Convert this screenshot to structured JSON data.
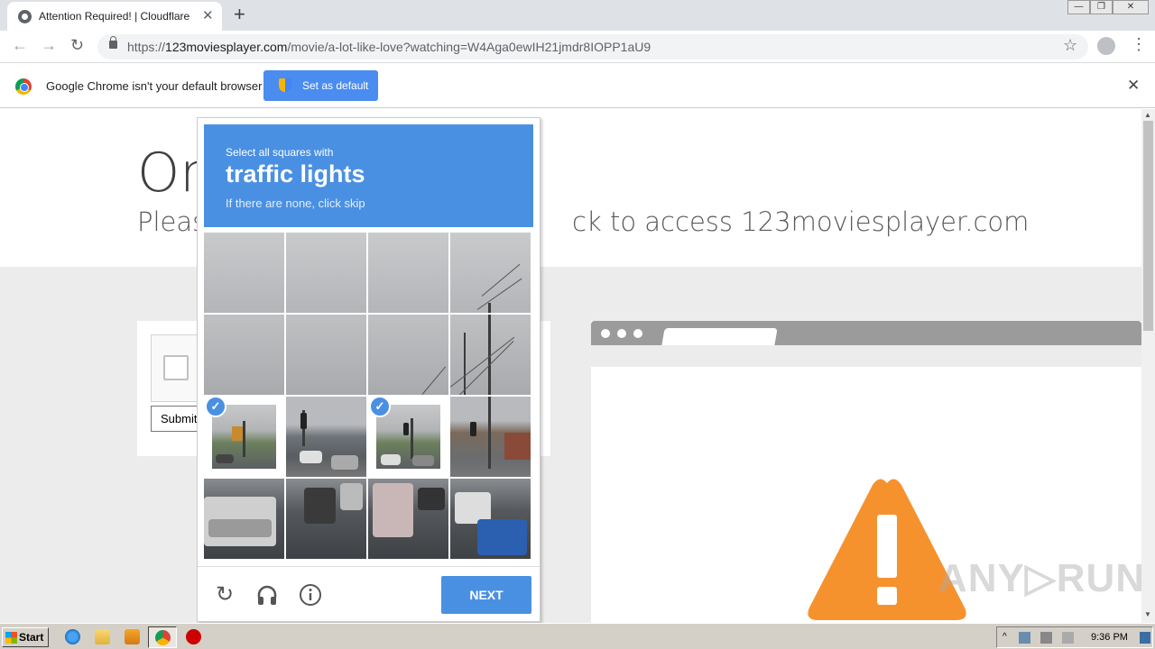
{
  "browser": {
    "tab_title": "Attention Required! | Cloudflare",
    "tab_close": "✕",
    "new_tab": "+",
    "url_domain": "123moviesplayer.com",
    "url_prefix": "https://",
    "url_path": "/movie/a-lot-like-love?watching=W4Aga0ewIH21jmdr8IOPP1aU9",
    "back_icon": "←",
    "forward_icon": "→",
    "reload_icon": "↻",
    "star_icon": "☆",
    "menu_icon": "⋮"
  },
  "infobar": {
    "message": "Google Chrome isn't your default browser",
    "button_label": "Set as default",
    "close": "✕"
  },
  "page": {
    "heading": "On",
    "subheading_left": "Pleas",
    "subheading_right": "ck to access 123moviesplayer.com",
    "submit_label": "Submit"
  },
  "captcha": {
    "instruction_small": "Select all squares with",
    "target": "traffic lights",
    "hint": "If there are none, click skip",
    "next_label": "NEXT",
    "selected_tiles": [
      8,
      10
    ],
    "check_glyph": "✓",
    "reload_icon": "↻",
    "audio_icon": "🎧",
    "info_icon": "ⓘ"
  },
  "watermark": "ANY▷RUN",
  "taskbar": {
    "start_label": "Start",
    "clock": "9:36 PM"
  },
  "colors": {
    "captcha_blue": "#4a90e2",
    "infobar_button": "#4a8cf0",
    "warning_orange": "#f6922e"
  }
}
